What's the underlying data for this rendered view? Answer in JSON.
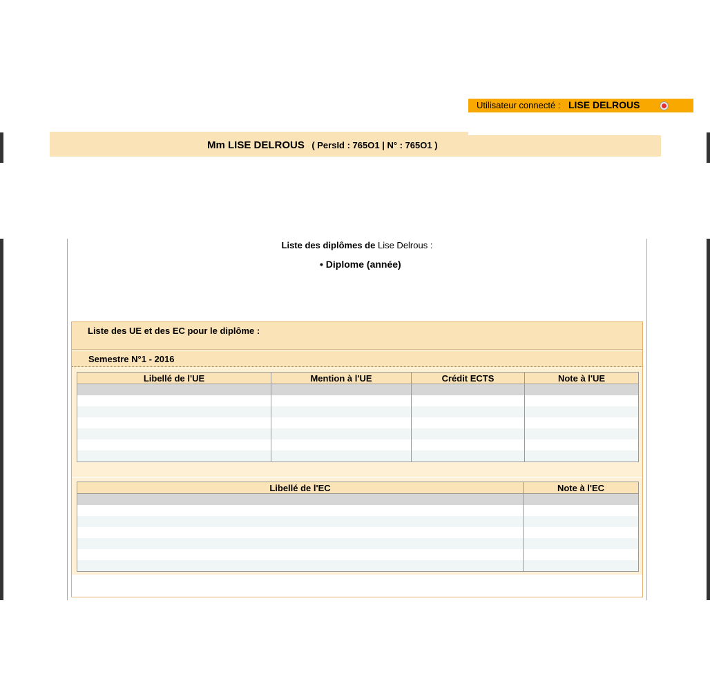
{
  "header": {
    "user_label": "Utilisateur connecté :",
    "user_name": "LISE DELROUS",
    "logout_icon": "power-off-icon",
    "bar_color": "#f9a800"
  },
  "person": {
    "name": "Mm LISE DELROUS",
    "ids": "( PersId : 765O1 | N° : 765O1 )"
  },
  "diplomas": {
    "title_bold": "Liste des diplômes de",
    "title_name": "Lise Delrous",
    "title_suffix": ":",
    "item": "• Diplome (année)"
  },
  "ue_section": {
    "header": "Liste des UE et des EC pour le diplôme :",
    "semester": "Semestre N°1 - 2016",
    "ue_table": {
      "columns": [
        "Libellé de l'UE",
        "Mention à l'UE",
        "Crédit ECTS",
        "Note à l'UE"
      ],
      "rows": [
        [
          "",
          "",
          "",
          ""
        ],
        [
          "",
          "",
          "",
          ""
        ],
        [
          "",
          "",
          "",
          ""
        ],
        [
          "",
          "",
          "",
          ""
        ],
        [
          "",
          "",
          "",
          ""
        ],
        [
          "",
          "",
          "",
          ""
        ],
        [
          "",
          "",
          "",
          ""
        ]
      ]
    },
    "ec_table": {
      "columns": [
        "Libellé de l'EC",
        "Note à l'EC"
      ],
      "rows": [
        [
          "",
          ""
        ],
        [
          "",
          ""
        ],
        [
          "",
          ""
        ],
        [
          "",
          ""
        ],
        [
          "",
          ""
        ],
        [
          "",
          ""
        ],
        [
          "",
          ""
        ]
      ]
    }
  },
  "colors": {
    "banner": "#fbe3b8",
    "table_header": "#fbe3b8",
    "row_selected": "#d6d6d6",
    "row_alt": "#f0f6f6"
  }
}
